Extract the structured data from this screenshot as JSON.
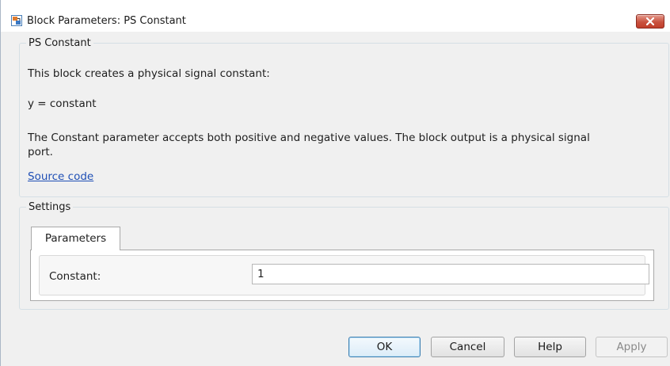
{
  "window": {
    "title": "Block Parameters: PS Constant"
  },
  "description_group": {
    "legend": "PS Constant",
    "line1": "This block creates a physical signal constant:",
    "equation": "y = constant",
    "line2a": "The Constant parameter accepts both positive and negative values. The block output is a physical signal",
    "line2b": "port.",
    "source_link": "Source code"
  },
  "settings_group": {
    "legend": "Settings",
    "tabs": [
      {
        "label": "Parameters",
        "active": true
      }
    ],
    "params": [
      {
        "label": "Constant:",
        "value": "1"
      }
    ]
  },
  "buttons": {
    "ok": "OK",
    "cancel": "Cancel",
    "help": "Help",
    "apply": "Apply"
  },
  "colors": {
    "close_button": "#c9523f",
    "link": "#1f4fb5",
    "background": "#f0f0f0"
  }
}
